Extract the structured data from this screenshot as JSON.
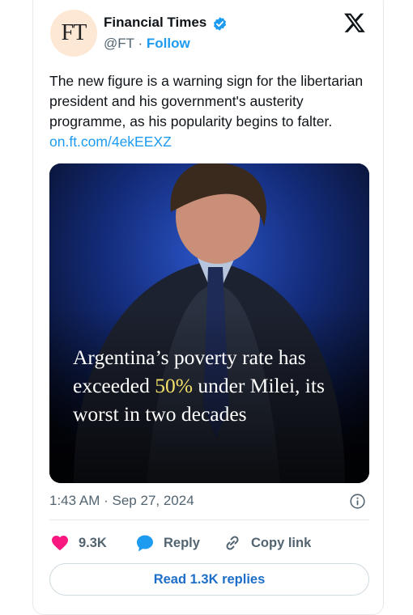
{
  "author": {
    "avatar_text": "FT",
    "display_name": "Financial Times",
    "handle": "@FT",
    "separator": "·",
    "follow_label": "Follow"
  },
  "tweet": {
    "text": "The new figure is a warning sign for the libertarian president and his government's austerity programme, as his popularity begins to falter.",
    "link": "on.ft.com/4ekEEXZ"
  },
  "media": {
    "headline_before": "Argentina’s poverty rate has exceeded ",
    "headline_highlight": "50%",
    "headline_after": " under Milei, its worst in two decades"
  },
  "meta": {
    "time": "1:43 AM",
    "separator": "·",
    "date": "Sep 27, 2024"
  },
  "actions": {
    "likes_count": "9.3K",
    "reply_label": "Reply",
    "copy_link_label": "Copy link",
    "read_replies_label": "Read 1.3K replies"
  },
  "colors": {
    "accent": "#1d9bf0",
    "like_heart": "#f91880",
    "text_secondary": "#536471",
    "headline_highlight": "#f3e06a"
  },
  "icons": [
    "verified-badge-icon",
    "x-logo-icon",
    "info-icon",
    "heart-icon",
    "reply-bubble-icon",
    "copy-link-icon"
  ]
}
